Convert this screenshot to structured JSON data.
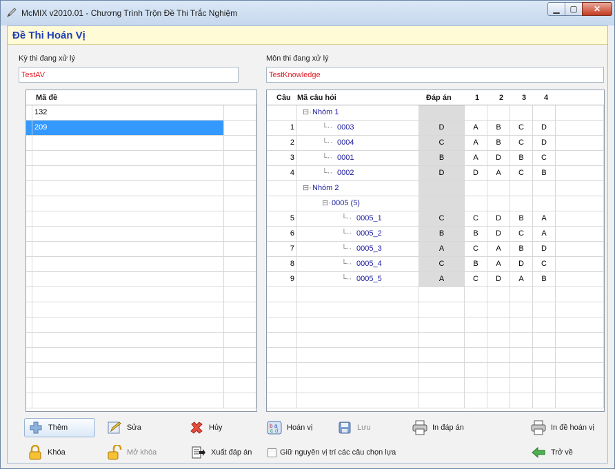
{
  "window": {
    "title": "McMIX v2010.01 - Chương Trình Trộn Đề Thi Trắc Nghiệm",
    "min": "▁",
    "max": "▢",
    "close": "✕"
  },
  "header": {
    "title": "Đề Thi Hoán Vị"
  },
  "exam": {
    "label": "Kỳ thi đang xử lý",
    "value": "TestAV"
  },
  "subject": {
    "label": "Môn thi đang xử lý",
    "value": "TestKnowledge"
  },
  "left_grid": {
    "header": "Mã đề",
    "rows": [
      "132",
      "209"
    ],
    "selected": 1
  },
  "right_grid": {
    "headers": [
      "Câu",
      "Mã câu hỏi",
      "Đáp án",
      "1",
      "2",
      "3",
      "4"
    ],
    "rows": [
      {
        "no": "",
        "code": "Nhóm 1",
        "ans": "",
        "c1": "",
        "c2": "",
        "c3": "",
        "c4": "",
        "type": "group",
        "level": 0
      },
      {
        "no": "1",
        "code": "0003",
        "ans": "D",
        "c1": "A",
        "c2": "B",
        "c3": "C",
        "c4": "D",
        "type": "item",
        "level": 1
      },
      {
        "no": "2",
        "code": "0004",
        "ans": "C",
        "c1": "A",
        "c2": "B",
        "c3": "C",
        "c4": "D",
        "type": "item",
        "level": 1
      },
      {
        "no": "3",
        "code": "0001",
        "ans": "B",
        "c1": "A",
        "c2": "D",
        "c3": "B",
        "c4": "C",
        "type": "item",
        "level": 1
      },
      {
        "no": "4",
        "code": "0002",
        "ans": "D",
        "c1": "D",
        "c2": "A",
        "c3": "C",
        "c4": "B",
        "type": "item",
        "level": 1
      },
      {
        "no": "",
        "code": "Nhóm 2",
        "ans": "",
        "c1": "",
        "c2": "",
        "c3": "",
        "c4": "",
        "type": "group",
        "level": 0
      },
      {
        "no": "",
        "code": "0005 (5)",
        "ans": "",
        "c1": "",
        "c2": "",
        "c3": "",
        "c4": "",
        "type": "group",
        "level": 1
      },
      {
        "no": "5",
        "code": "0005_1",
        "ans": "C",
        "c1": "C",
        "c2": "D",
        "c3": "B",
        "c4": "A",
        "type": "item",
        "level": 2
      },
      {
        "no": "6",
        "code": "0005_2",
        "ans": "B",
        "c1": "B",
        "c2": "D",
        "c3": "C",
        "c4": "A",
        "type": "item",
        "level": 2
      },
      {
        "no": "7",
        "code": "0005_3",
        "ans": "A",
        "c1": "C",
        "c2": "A",
        "c3": "B",
        "c4": "D",
        "type": "item",
        "level": 2
      },
      {
        "no": "8",
        "code": "0005_4",
        "ans": "C",
        "c1": "B",
        "c2": "A",
        "c3": "D",
        "c4": "C",
        "type": "item",
        "level": 2
      },
      {
        "no": "9",
        "code": "0005_5",
        "ans": "A",
        "c1": "C",
        "c2": "D",
        "c3": "A",
        "c4": "B",
        "type": "item",
        "level": 2
      }
    ]
  },
  "toolbar": {
    "add": "Thêm",
    "edit": "Sửa",
    "cancel": "Hủy",
    "permute": "Hoán vị",
    "save": "Lưu",
    "print_answers": "In đáp án",
    "print_permuted": "In đề hoán vị",
    "lock": "Khóa",
    "unlock": "Mở khóa",
    "export_answers": "Xuất đáp án",
    "keep_order": "Giữ nguyên vị trí các câu chọn lựa",
    "back": "Trở về"
  },
  "colors": {
    "accent": "#1f3eb6",
    "selection": "#3399ff",
    "input_text": "#e0202a",
    "header_band": "#fffbd6"
  }
}
